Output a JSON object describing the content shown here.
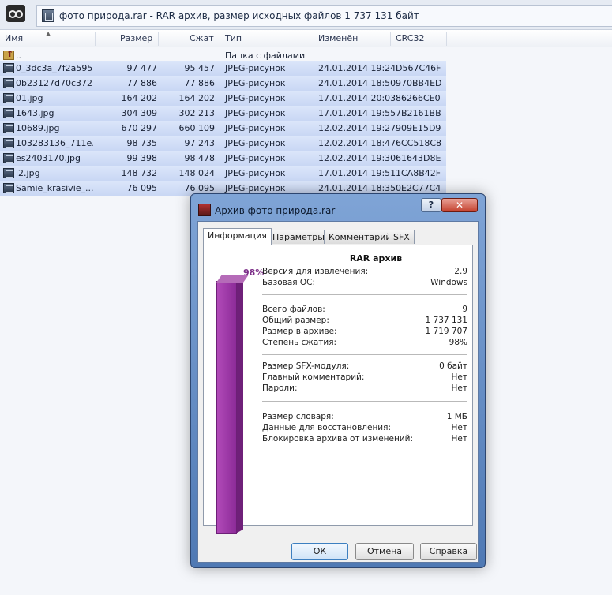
{
  "window_title": "фото природа.rar - RAR архив, размер исходных файлов 1 737 131 байт",
  "columns": {
    "name": "Имя",
    "size": "Размер",
    "packed": "Сжат",
    "type": "Тип",
    "modified": "Изменён",
    "crc": "CRC32"
  },
  "parent_row": {
    "name": "..",
    "type": "Папка с файлами"
  },
  "files": [
    {
      "name": "0_3dc3a_7f2a595...",
      "size": "97 477",
      "packed": "95 457",
      "type": "JPEG-рисунок",
      "modified": "24.01.2014 19:24",
      "crc": "D567C46F"
    },
    {
      "name": "0b23127d70c372...",
      "size": "77 886",
      "packed": "77 886",
      "type": "JPEG-рисунок",
      "modified": "24.01.2014 18:50",
      "crc": "970BB4ED"
    },
    {
      "name": "01.jpg",
      "size": "164 202",
      "packed": "164 202",
      "type": "JPEG-рисунок",
      "modified": "17.01.2014 20:03",
      "crc": "86266CE0"
    },
    {
      "name": "1643.jpg",
      "size": "304 309",
      "packed": "302 213",
      "type": "JPEG-рисунок",
      "modified": "17.01.2014 19:55",
      "crc": "7B2161BB"
    },
    {
      "name": "10689.jpg",
      "size": "670 297",
      "packed": "660 109",
      "type": "JPEG-рисунок",
      "modified": "12.02.2014 19:27",
      "crc": "909E15D9"
    },
    {
      "name": "103283136_711e...",
      "size": "98 735",
      "packed": "97 243",
      "type": "JPEG-рисунок",
      "modified": "12.02.2014 18:47",
      "crc": "6CC518C8"
    },
    {
      "name": "es2403170.jpg",
      "size": "99 398",
      "packed": "98 478",
      "type": "JPEG-рисунок",
      "modified": "12.02.2014 19:30",
      "crc": "61643D8E"
    },
    {
      "name": "l2.jpg",
      "size": "148 732",
      "packed": "148 024",
      "type": "JPEG-рисунок",
      "modified": "17.01.2014 19:51",
      "crc": "1CA8B42F"
    },
    {
      "name": "Samie_krasivie_...",
      "size": "76 095",
      "packed": "76 095",
      "type": "JPEG-рисунок",
      "modified": "24.01.2014 18:35",
      "crc": "0E2C77C4"
    }
  ],
  "dialog": {
    "title": "Архив фото природа.rar",
    "help": "?",
    "close": "✕",
    "tabs": [
      "Информация",
      "Параметры",
      "Комментарий",
      "SFX"
    ],
    "ratio_label": "98%",
    "ratio_fill": 0.98,
    "heading": "RAR архив",
    "group1": [
      {
        "k": "Версия для извлечения:",
        "v": "2.9"
      },
      {
        "k": "Базовая ОС:",
        "v": "Windows"
      }
    ],
    "group2": [
      {
        "k": "Всего файлов:",
        "v": "9"
      },
      {
        "k": "Общий размер:",
        "v": "1 737 131"
      },
      {
        "k": "Размер в архиве:",
        "v": "1 719 707"
      },
      {
        "k": "Степень сжатия:",
        "v": "98%"
      }
    ],
    "group3": [
      {
        "k": "Размер SFX-модуля:",
        "v": "0 байт"
      },
      {
        "k": "Главный комментарий:",
        "v": "Нет"
      },
      {
        "k": "Пароли:",
        "v": "Нет"
      }
    ],
    "group4": [
      {
        "k": "Размер словаря:",
        "v": "1 МБ"
      },
      {
        "k": "Данные для восстановления:",
        "v": "Нет"
      },
      {
        "k": "Блокировка архива от изменений:",
        "v": "Нет"
      }
    ],
    "buttons": {
      "ok": "ОК",
      "cancel": "Отмена",
      "help": "Справка"
    }
  },
  "colors": {
    "selection": "#c9d7f4",
    "ratio_bar": "#9a34a5",
    "dialog_frame": "#5f86c0"
  }
}
